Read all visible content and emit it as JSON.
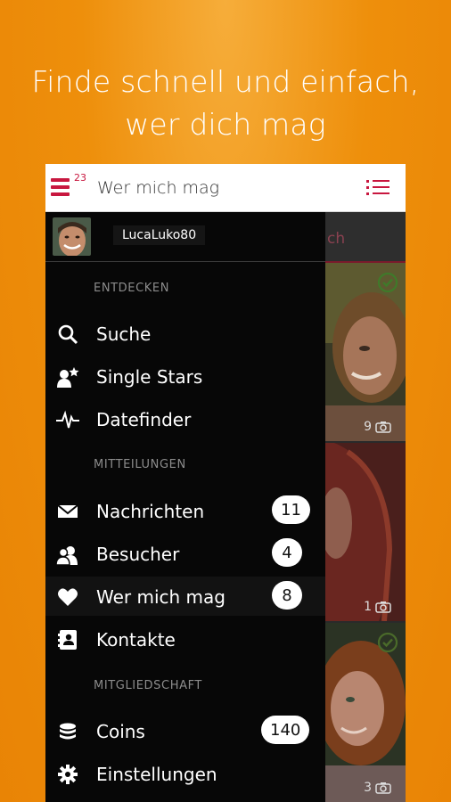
{
  "tagline": {
    "line1": "Finde schnell und einfach,",
    "line2": "wer dich mag"
  },
  "appbar": {
    "title": "Wer mich mag",
    "menu_badge": "23",
    "menu_icon": "hamburger-icon",
    "list_icon": "list-view-icon"
  },
  "profile": {
    "username": "LucaLuko80"
  },
  "sections": {
    "discover": "ENTDECKEN",
    "messages": "MITTEILUNGEN",
    "membership": "MITGLIEDSCHAFT"
  },
  "menu": {
    "search": {
      "label": "Suche",
      "icon": "search-icon"
    },
    "single_stars": {
      "label": "Single Stars",
      "icon": "single-stars-icon"
    },
    "datefinder": {
      "label": "Datefinder",
      "icon": "pulse-icon"
    },
    "messages": {
      "label": "Nachrichten",
      "badge": "11",
      "icon": "envelope-icon"
    },
    "visitors": {
      "label": "Besucher",
      "badge": "4",
      "icon": "visitors-icon"
    },
    "likes": {
      "label": "Wer mich mag",
      "badge": "8",
      "icon": "heart-icon"
    },
    "contacts": {
      "label": "Kontakte",
      "icon": "contacts-icon"
    },
    "coins": {
      "label": "Coins",
      "badge": "140",
      "icon": "coins-icon"
    },
    "settings": {
      "label": "Einstellungen",
      "icon": "gear-icon"
    }
  },
  "background": {
    "tab_partial": "ch",
    "photo_counts": [
      "9",
      "1",
      "3"
    ]
  },
  "colors": {
    "background": "#ee8f0b",
    "accent": "#c8173f",
    "drawer": "#070707"
  }
}
